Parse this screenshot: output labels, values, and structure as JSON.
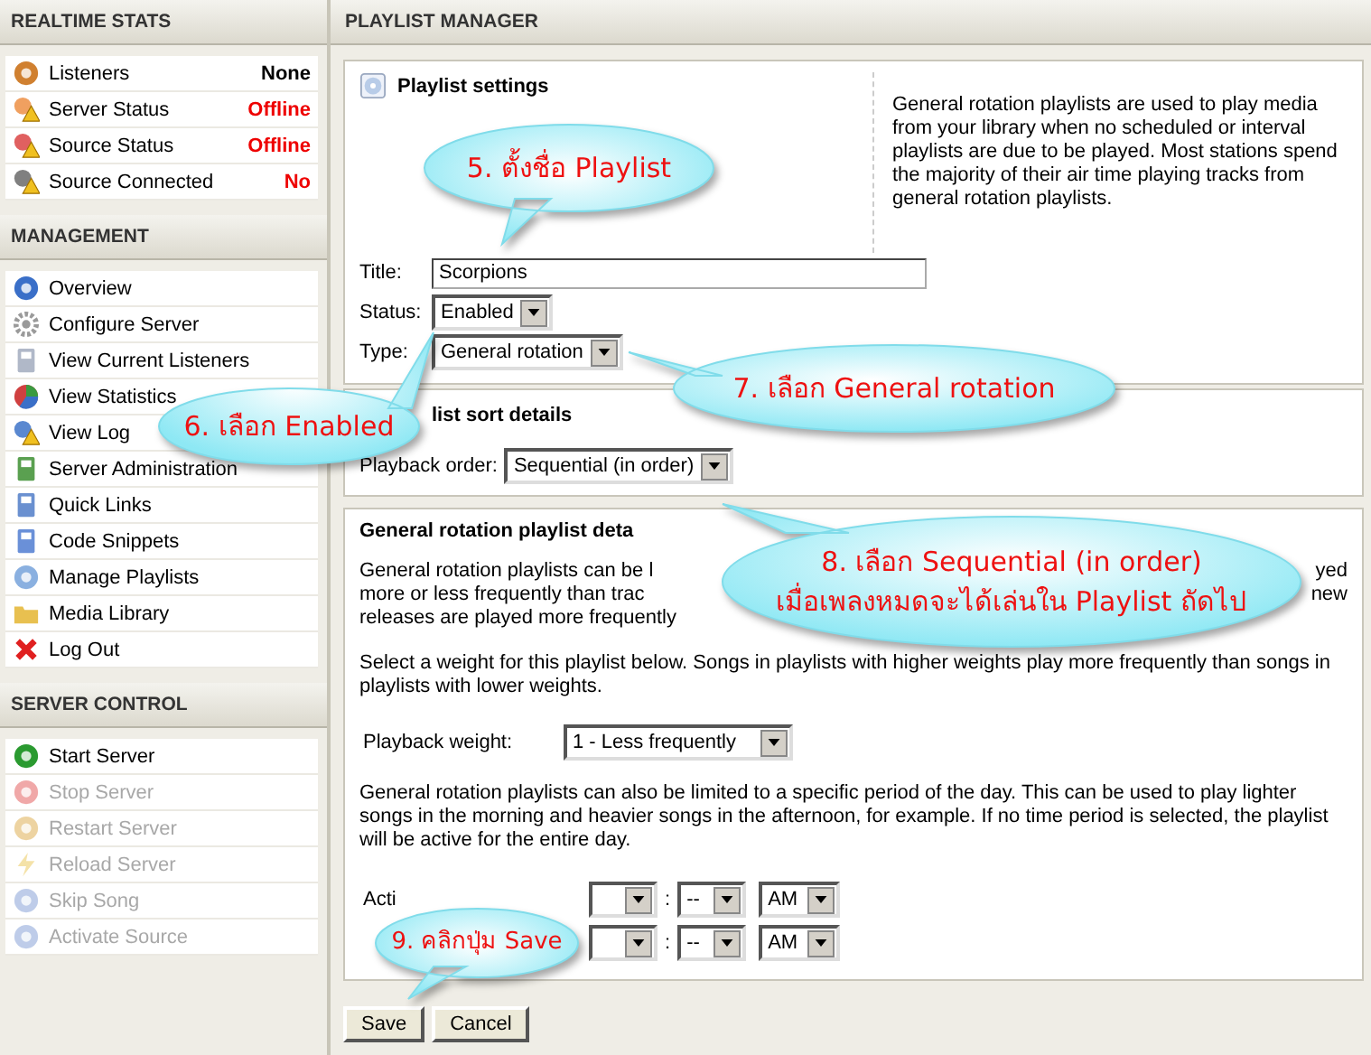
{
  "sidebar": {
    "sections": [
      {
        "title": "REALTIME STATS",
        "kind": "stats",
        "items": [
          {
            "label": "Listeners",
            "value": "None",
            "color": "#000000"
          },
          {
            "label": "Server Status",
            "value": "Offline",
            "color": "#ee0000"
          },
          {
            "label": "Source Status",
            "value": "Offline",
            "color": "#ee0000"
          },
          {
            "label": "Source Connected",
            "value": "No",
            "color": "#ee0000"
          }
        ]
      },
      {
        "title": "MANAGEMENT",
        "kind": "menu",
        "items": [
          {
            "label": "Overview",
            "disabled": false
          },
          {
            "label": "Configure Server",
            "disabled": false
          },
          {
            "label": "View Current Listeners",
            "disabled": false
          },
          {
            "label": "View Statistics",
            "disabled": false
          },
          {
            "label": "View Log",
            "disabled": false
          },
          {
            "label": "Server Administration",
            "disabled": false
          },
          {
            "label": "Quick Links",
            "disabled": false
          },
          {
            "label": "Code Snippets",
            "disabled": false
          },
          {
            "label": "Manage Playlists",
            "disabled": false
          },
          {
            "label": "Media Library",
            "disabled": false
          },
          {
            "label": "Log Out",
            "disabled": false
          }
        ]
      },
      {
        "title": "SERVER CONTROL",
        "kind": "menu",
        "items": [
          {
            "label": "Start Server",
            "disabled": false
          },
          {
            "label": "Stop Server",
            "disabled": true
          },
          {
            "label": "Restart Server",
            "disabled": true
          },
          {
            "label": "Reload Server",
            "disabled": true
          },
          {
            "label": "Skip Song",
            "disabled": true
          },
          {
            "label": "Activate Source",
            "disabled": true
          }
        ]
      }
    ]
  },
  "main": {
    "title": "PLAYLIST MANAGER",
    "settings": {
      "heading": "Playlist settings",
      "description": "General rotation playlists are used to play media from your library when no scheduled or interval playlists are due to be played. Most stations spend the majority of their air time playing tracks from general rotation playlists.",
      "fields": [
        {
          "label": "Title:",
          "kind": "text",
          "value": "Scorpions"
        },
        {
          "label": "Status:",
          "kind": "select",
          "value": "Enabled"
        },
        {
          "label": "Type:",
          "kind": "select",
          "value": "General rotation"
        }
      ]
    },
    "sort": {
      "heading": "list sort details",
      "label": "Playback order:",
      "value": "Sequential (in order)"
    },
    "rotation": {
      "heading": "General rotation playlist deta",
      "intro_lines": [
        {
          "left": "General rotation playlists can be l",
          "right": "yed"
        },
        {
          "left": "more or less frequently than trac",
          "right": "new"
        },
        {
          "left": "releases are played more frequently"
        }
      ],
      "weight_text": "Select a weight for this playlist below. Songs in playlists with higher weights play more frequently than songs in playlists with lower weights.",
      "weight_label": "Playback weight:",
      "weight_value": "1 - Less frequently",
      "period_text": "General rotation playlists can also be limited to a specific period of the day. This can be used to play lighter songs in the morning and heavier songs in the afternoon, for example. If no time period is selected, the playlist will be active for the entire day.",
      "times": [
        {
          "label": "Acti",
          "separator": ":",
          "minute": "--",
          "ampm": "AM"
        },
        {
          "separator": ":",
          "minute": "--",
          "ampm": "AM"
        }
      ]
    },
    "buttons": [
      "Save",
      "Cancel"
    ]
  },
  "callouts": [
    {
      "text": "5. ตั้งชื่อ Playlist"
    },
    {
      "text": "6. เลือก Enabled"
    },
    {
      "text": "7. เลือก General rotation"
    },
    {
      "text": "8. เลือก Sequential (in order)",
      "text2": "เมื่อเพลงหมดจะได้เล่นใน Playlist ถัดไป"
    },
    {
      "text": "9. คลิกปุ่ม Save"
    }
  ]
}
